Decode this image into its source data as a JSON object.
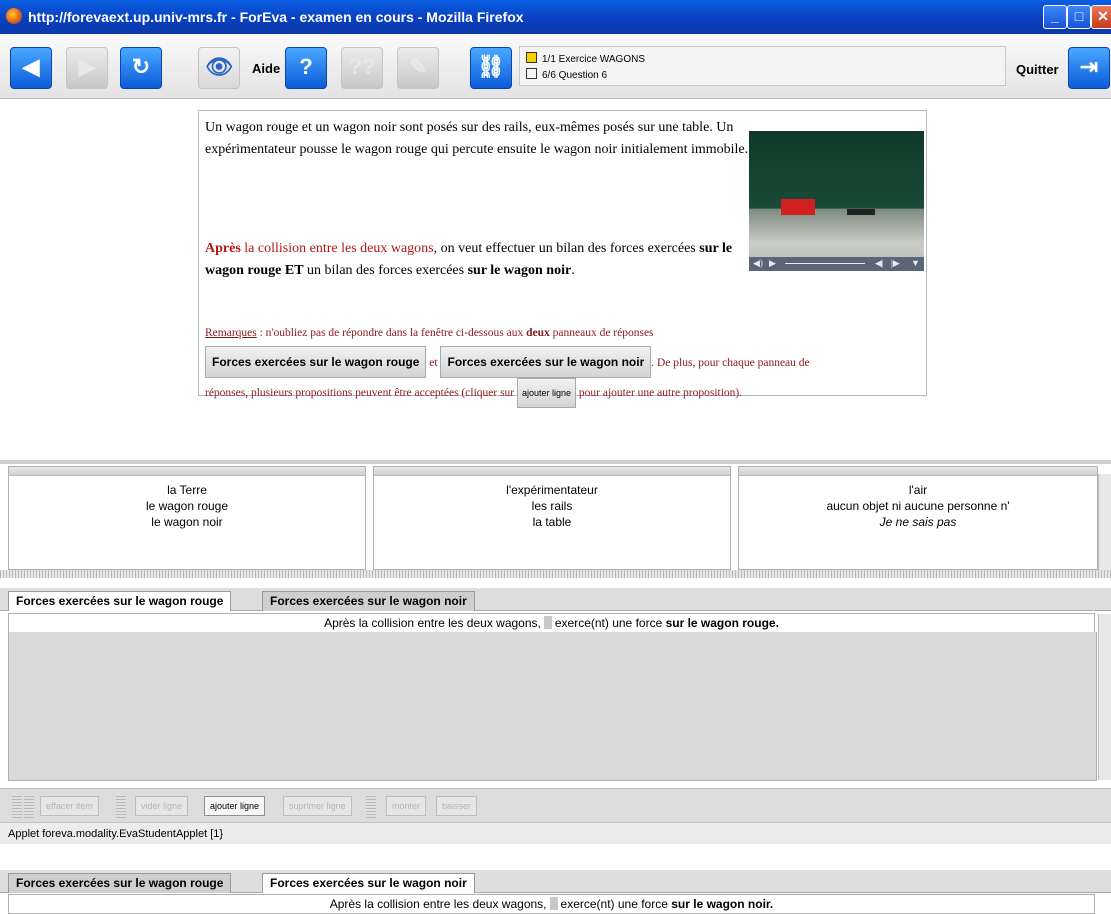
{
  "window": {
    "title": "http://forevaext.up.univ-mrs.fr - ForEva - examen en cours - Mozilla Firefox",
    "controls": [
      "minimize-icon",
      "maximize-icon",
      "close-icon"
    ]
  },
  "toolbar": {
    "aide_label": "Aide",
    "quitter_label": "Quitter",
    "exercise_line": "1/1  Exercice WAGONS",
    "question_line": "6/6  Question 6"
  },
  "question": {
    "para1": "Un wagon rouge et un wagon noir sont posés sur des rails, eux-mêmes posés sur une table. Un expérimentateur pousse le wagon rouge qui percute ensuite le wagon noir initialement immobile.",
    "para2_apres": "Après",
    "para2_red": " la collision entre les deux wagons",
    "para2_rest1": ", on veut effectuer un bilan des forces exercées ",
    "para2_bold1": "sur le wagon rouge ET",
    "para2_rest2": " un bilan des forces exercées ",
    "para2_bold2": "sur le wagon noir",
    "para2_end": ".",
    "rem_label": "Remarques",
    "rem_text1": " : n'oubliez pas de répondre dans la fenêtre ci-dessous aux ",
    "rem_deux": "deux",
    "rem_text2": " panneaux de réponses",
    "btn_rouge": "Forces exercées sur le wagon rouge",
    "et": " et ",
    "btn_noir": "Forces exercées sur le wagon noir",
    "rem_text3": ". De plus, pour chaque panneau de",
    "rem_text4": "réponses, plusieurs propositions peuvent être acceptées (cliquer sur ",
    "btn_ajouter": "ajouter ligne",
    "rem_text5": " pour ajouter une autre proposition)."
  },
  "panels": [
    {
      "items": [
        "la Terre",
        "le wagon rouge",
        "le wagon noir"
      ]
    },
    {
      "items": [
        "l'expérimentateur",
        "les rails",
        "la table"
      ]
    },
    {
      "items": [
        "l'air",
        "aucun objet ni aucune personne n'",
        "Je ne sais pas"
      ]
    }
  ],
  "tabs": {
    "rouge": "Forces exercées sur le wagon rouge",
    "noir": "Forces exercées sur le wagon noir"
  },
  "sentence_rouge": {
    "pre": "Après la collision entre les deux wagons,",
    "mid": "exerce(nt) une force ",
    "bold": "sur le wagon rouge."
  },
  "sentence_noir": {
    "pre": "Après la collision entre les deux wagons,",
    "mid": "exerce(nt) une force ",
    "bold": "sur le wagon noir."
  },
  "bottom_toolbar": [
    "effacer item",
    "vider ligne",
    "ajouter ligne",
    "suprimer ligne",
    "monter",
    "baisser"
  ],
  "status": "Applet foreva.modality.EvaStudentApplet [1}"
}
